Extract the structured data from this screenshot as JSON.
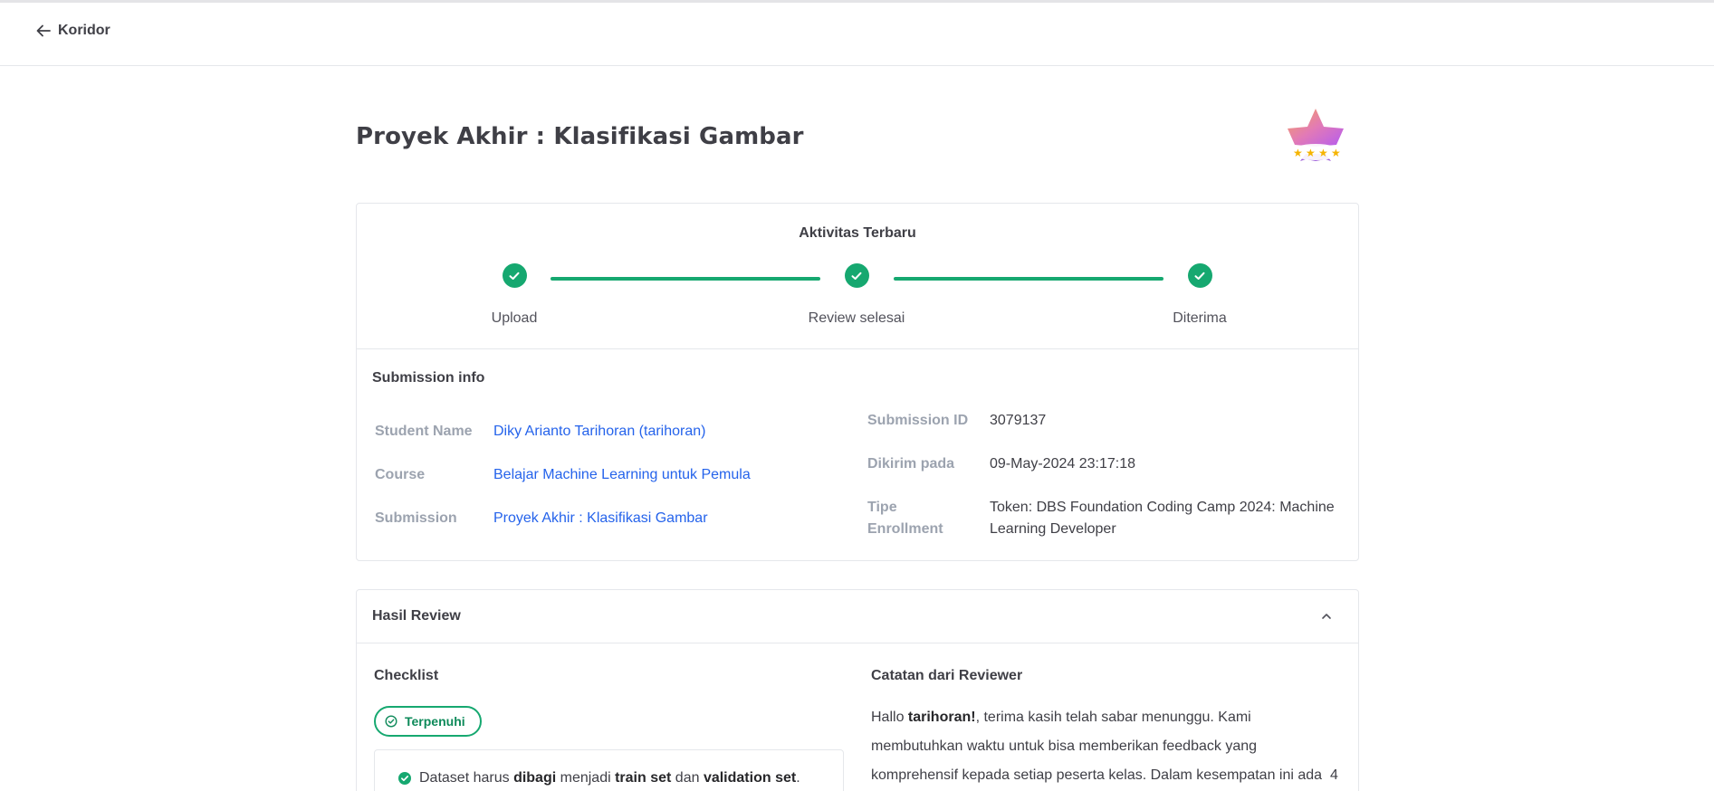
{
  "nav": {
    "back_label": "Koridor"
  },
  "page": {
    "title": "Proyek Akhir : Klasifikasi Gambar"
  },
  "activity": {
    "title": "Aktivitas Terbaru",
    "steps": [
      {
        "label": "Upload",
        "done": true
      },
      {
        "label": "Review selesai",
        "done": true
      },
      {
        "label": "Diterima",
        "done": true
      }
    ]
  },
  "submission_info": {
    "title": "Submission info",
    "left": [
      {
        "label": "Student Name",
        "value": "Diky Arianto Tarihoran (tarihoran)"
      },
      {
        "label": "Course",
        "value": "Belajar Machine Learning untuk Pemula"
      },
      {
        "label": "Submission",
        "value": "Proyek Akhir : Klasifikasi Gambar"
      }
    ],
    "right": [
      {
        "label": "Submission ID",
        "value": "3079137"
      },
      {
        "label": "Dikirim pada",
        "value": "09-May-2024 23:17:18"
      },
      {
        "label_line1": "Tipe",
        "label_line2": "Enrollment",
        "value_line1": "Token: DBS Foundation Coding Camp 2024: Machine",
        "value_line2": "Learning Developer"
      }
    ]
  },
  "review": {
    "title": "Hasil Review",
    "checklist": {
      "title": "Checklist",
      "status": "Terpenuhi",
      "item": {
        "p1": "Dataset harus ",
        "b1": "dibagi",
        "p2": " menjadi ",
        "b2": "train set",
        "p3": " dan ",
        "b3": "validation set",
        "p4": "."
      }
    },
    "notes": {
      "title": "Catatan dari Reviewer",
      "greeting": "Hallo ",
      "name": "tarihoran!",
      "line1_rest": ", terima kasih telah sabar menunggu. Kami",
      "line2": "membutuhkan waktu untuk bisa memberikan feedback yang",
      "line3": "komprehensif kepada setiap peserta kelas. Dalam kesempatan ini ada  4"
    }
  },
  "colors": {
    "accent": "#16a870",
    "link": "#2563eb",
    "label_gray": "#9ca3af"
  },
  "icons": [
    "arrow-left-icon",
    "check-icon",
    "chevron-up-icon",
    "check-circle-outline-icon",
    "check-circle-icon",
    "star-badge-icon"
  ]
}
